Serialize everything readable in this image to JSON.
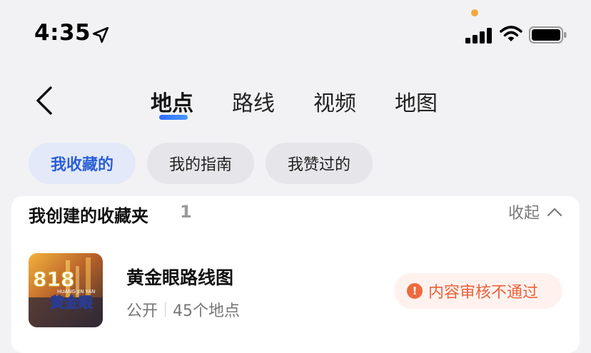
{
  "status_bar": {
    "time": "4:35",
    "icons": [
      "location-arrow-icon",
      "signal-icon",
      "wifi-icon",
      "battery-icon"
    ]
  },
  "nav": {
    "back_icon": "chevron-left-icon",
    "tabs": [
      {
        "label": "地点",
        "active": true
      },
      {
        "label": "路线",
        "active": false
      },
      {
        "label": "视频",
        "active": false
      },
      {
        "label": "地图",
        "active": false
      }
    ]
  },
  "filters": [
    {
      "label": "我收藏的",
      "active": true
    },
    {
      "label": "我的指南",
      "active": false
    },
    {
      "label": "我赞过的",
      "active": false
    }
  ],
  "section": {
    "title": "我创建的收藏夹",
    "count": "1",
    "collapse_label": "收起"
  },
  "item": {
    "title": "黄金眼路线图",
    "visibility": "公开",
    "places": "45个地点",
    "status": "内容审核不通过",
    "thumb_text": {
      "number": "818",
      "name": "黄金眼",
      "pinyin": "HUANG JIN YAN"
    }
  },
  "colors": {
    "accent": "#2f6bff",
    "warning": "#e8633c",
    "warning_bg": "#fff2ee"
  }
}
